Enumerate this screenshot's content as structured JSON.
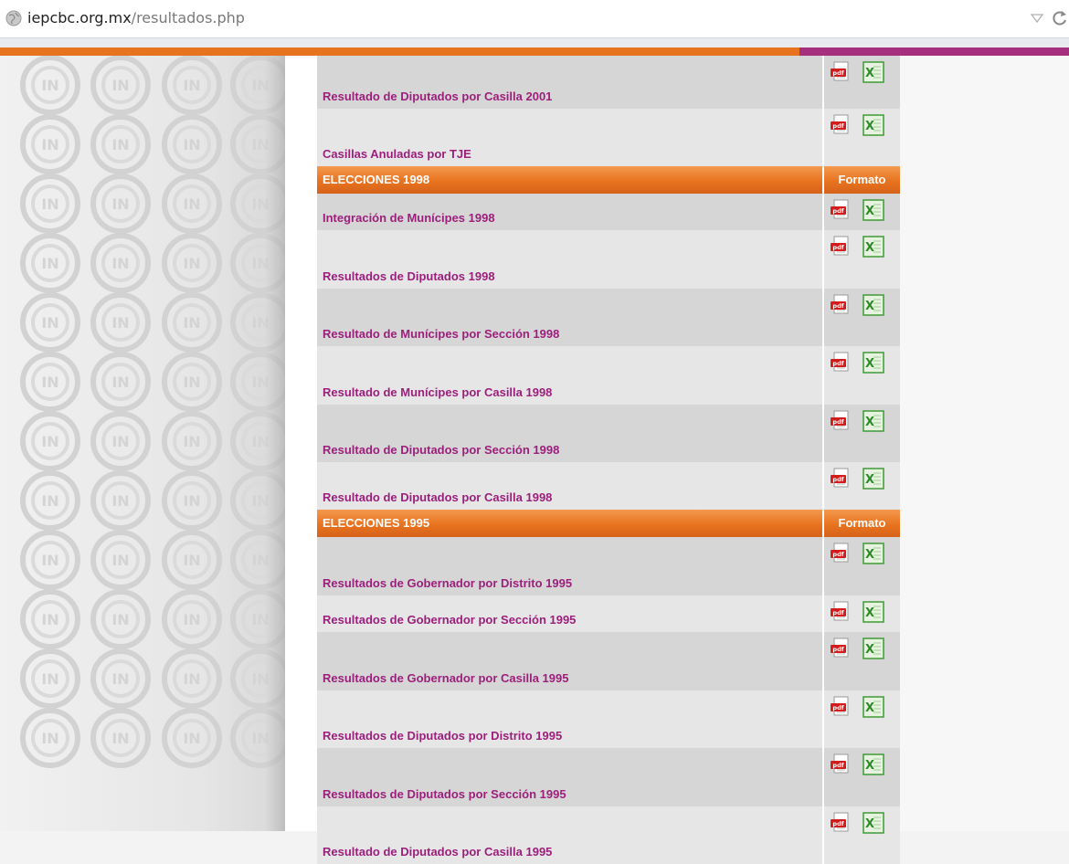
{
  "browser": {
    "url_host": "iepcbc.org.mx",
    "url_path": "/resultados.php"
  },
  "colors": {
    "accent_orange": "#e8731f",
    "accent_purple": "#a4307e",
    "link": "#9c1f7c"
  },
  "icons": {
    "pdf": "pdf-icon",
    "excel": "excel-icon"
  },
  "sections": [
    {
      "header": null,
      "rows": [
        {
          "label": "Resultado de Diputados por Casilla 2001"
        },
        {
          "label": "Casillas Anuladas por TJE"
        }
      ]
    },
    {
      "header": {
        "title": "ELECCIONES 1998",
        "format_label": "Formato"
      },
      "rows": [
        {
          "label": "Integración de Munícipes 1998"
        },
        {
          "label": "Resultados de Diputados 1998"
        },
        {
          "label": "Resultado de Munícipes por Sección 1998"
        },
        {
          "label": "Resultado de Munícipes por Casilla 1998"
        },
        {
          "label": "Resultado de Diputados por Sección 1998"
        },
        {
          "label": "Resultado de Diputados por Casilla 1998"
        }
      ]
    },
    {
      "header": {
        "title": "ELECCIONES 1995",
        "format_label": "Formato"
      },
      "rows": [
        {
          "label": "Resultados de Gobernador por Distrito 1995"
        },
        {
          "label": "Resultados de Gobernador por Sección 1995"
        },
        {
          "label": "Resultados de Gobernador por Casilla 1995"
        },
        {
          "label": "Resultados de Diputados por Distrito 1995"
        },
        {
          "label": "Resultados de Diputados por Sección 1995"
        },
        {
          "label": "Resultado de Diputados por Casilla 1995"
        }
      ]
    }
  ]
}
